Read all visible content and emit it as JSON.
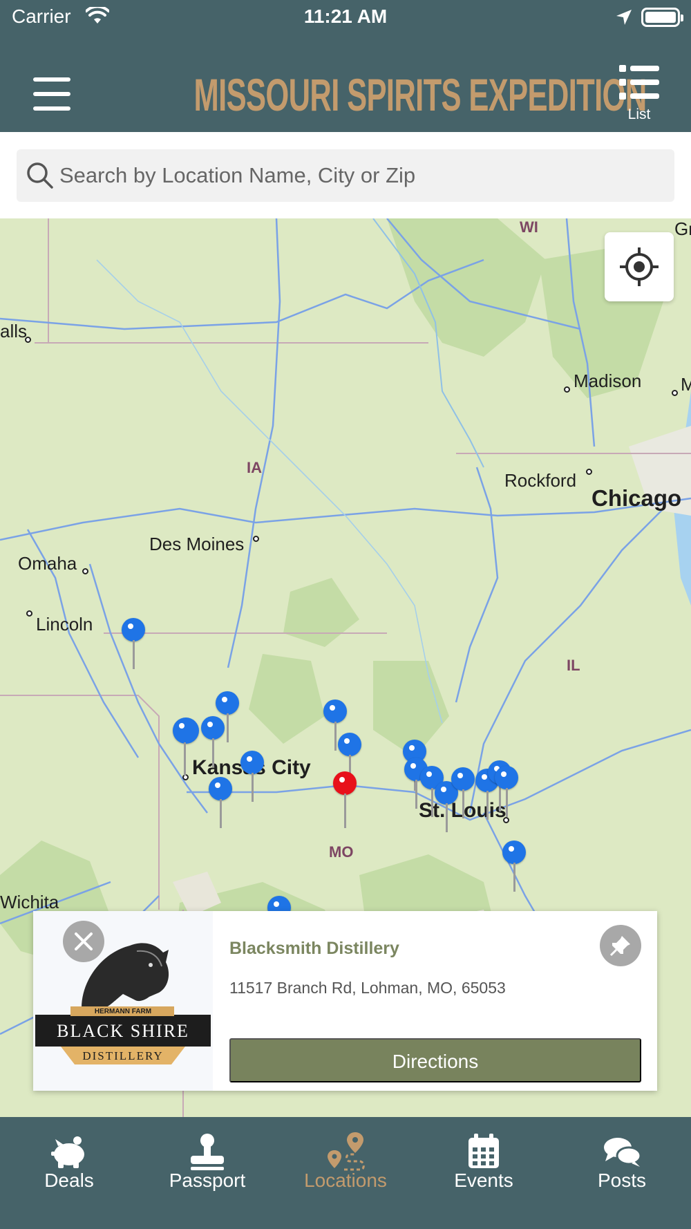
{
  "status_bar": {
    "carrier": "Carrier",
    "time": "11:21 AM"
  },
  "header": {
    "title": "MISSOURI SPIRITS EXPEDITION",
    "list_label": "List",
    "brand_color": "#c39b6d",
    "bar_color": "#466369"
  },
  "search": {
    "placeholder": "Search by Location Name, City or Zip",
    "value": ""
  },
  "map": {
    "labels": {
      "wi": "WI",
      "gr": "Gr",
      "falls": "alls",
      "madison": "Madison",
      "m": "M",
      "ia": "IA",
      "rockford": "Rockford",
      "chicago": "Chicago",
      "des_moines": "Des Moines",
      "omaha": "Omaha",
      "lincoln": "Lincoln",
      "il": "IL",
      "kansas_city": "Kansas City",
      "st_louis": "St. Louis",
      "mo": "MO",
      "wichita": "Wichita"
    },
    "pins": {
      "blue_color": "#1f74e6",
      "selected_color": "#e8101a"
    }
  },
  "card": {
    "title": "Blacksmith Distillery",
    "address": "11517 Branch Rd, Lohman, MO, 65053",
    "directions_label": "Directions",
    "logo": {
      "top_text": "HERMANN FARM",
      "main_text": "BLACK SHIRE",
      "bottom_text": "DISTILLERY"
    }
  },
  "tabs": [
    {
      "label": "Deals",
      "icon": "piggy-bank-icon"
    },
    {
      "label": "Passport",
      "icon": "stamp-icon"
    },
    {
      "label": "Locations",
      "icon": "map-route-icon",
      "active": true
    },
    {
      "label": "Events",
      "icon": "calendar-icon"
    },
    {
      "label": "Posts",
      "icon": "chat-bubbles-icon"
    }
  ]
}
